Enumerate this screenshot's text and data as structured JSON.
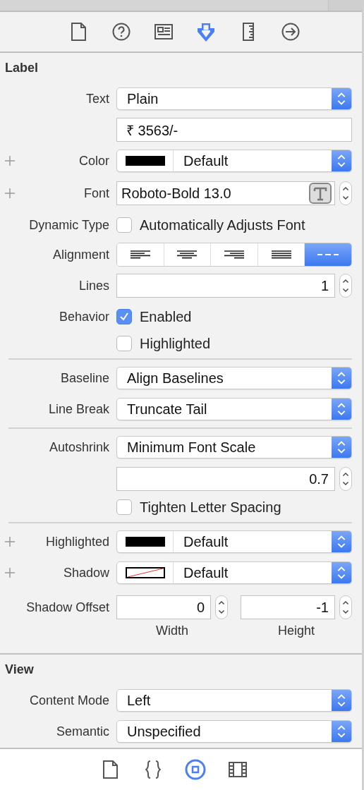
{
  "inspector_tabs": [
    {
      "selected": false
    },
    {
      "selected": false
    },
    {
      "selected": false
    },
    {
      "selected": true
    },
    {
      "selected": false
    },
    {
      "selected": false
    }
  ],
  "sections": [
    {
      "title": "Label",
      "rows": [
        {
          "kind": "popup",
          "label": "Text",
          "value": "Plain"
        },
        {
          "kind": "textfield",
          "value": "₹ 3563/-"
        },
        {
          "kind": "color",
          "label": "Color",
          "plus": true,
          "value": "Default"
        },
        {
          "kind": "font",
          "label": "Font",
          "plus": true,
          "value": "Roboto-Bold 13.0"
        },
        {
          "kind": "checkbox",
          "label": "Dynamic Type",
          "text": "Automatically Adjusts Font",
          "checked": false
        },
        {
          "kind": "segmented",
          "label": "Alignment",
          "segments": [
            {
              "selected": false
            },
            {
              "selected": false
            },
            {
              "selected": false
            },
            {
              "selected": false
            },
            {
              "selected": true
            }
          ]
        },
        {
          "kind": "stepper",
          "label": "Lines",
          "value": "1"
        },
        {
          "kind": "checkbox",
          "label": "Behavior",
          "text": "Enabled",
          "checked": true
        },
        {
          "kind": "checkbox",
          "text": "Highlighted",
          "checked": false
        },
        {
          "kind": "divider"
        },
        {
          "kind": "popup",
          "label": "Baseline",
          "value": "Align Baselines"
        },
        {
          "kind": "popup",
          "label": "Line Break",
          "value": "Truncate Tail"
        },
        {
          "kind": "divider"
        },
        {
          "kind": "popup",
          "label": "Autoshrink",
          "value": "Minimum Font Scale"
        },
        {
          "kind": "stepper",
          "value": "0.7"
        },
        {
          "kind": "checkbox",
          "text": "Tighten Letter Spacing",
          "checked": false
        },
        {
          "kind": "divider"
        },
        {
          "kind": "color",
          "label": "Highlighted",
          "plus": true,
          "value": "Default"
        },
        {
          "kind": "nocolor",
          "label": "Shadow",
          "plus": true,
          "value": "Default"
        },
        {
          "kind": "offset",
          "label": "Shadow Offset",
          "fields": [
            {
              "value": "0",
              "caption": "Width"
            },
            {
              "value": "-1",
              "caption": "Height"
            }
          ]
        }
      ]
    },
    {
      "title": "View",
      "rows": [
        {
          "kind": "popup",
          "label": "Content Mode",
          "value": "Left"
        },
        {
          "kind": "popup",
          "label": "Semantic",
          "value": "Unspecified"
        }
      ]
    }
  ],
  "library_tabs": [
    {
      "selected": false
    },
    {
      "selected": false
    },
    {
      "selected": true
    },
    {
      "selected": false
    }
  ]
}
